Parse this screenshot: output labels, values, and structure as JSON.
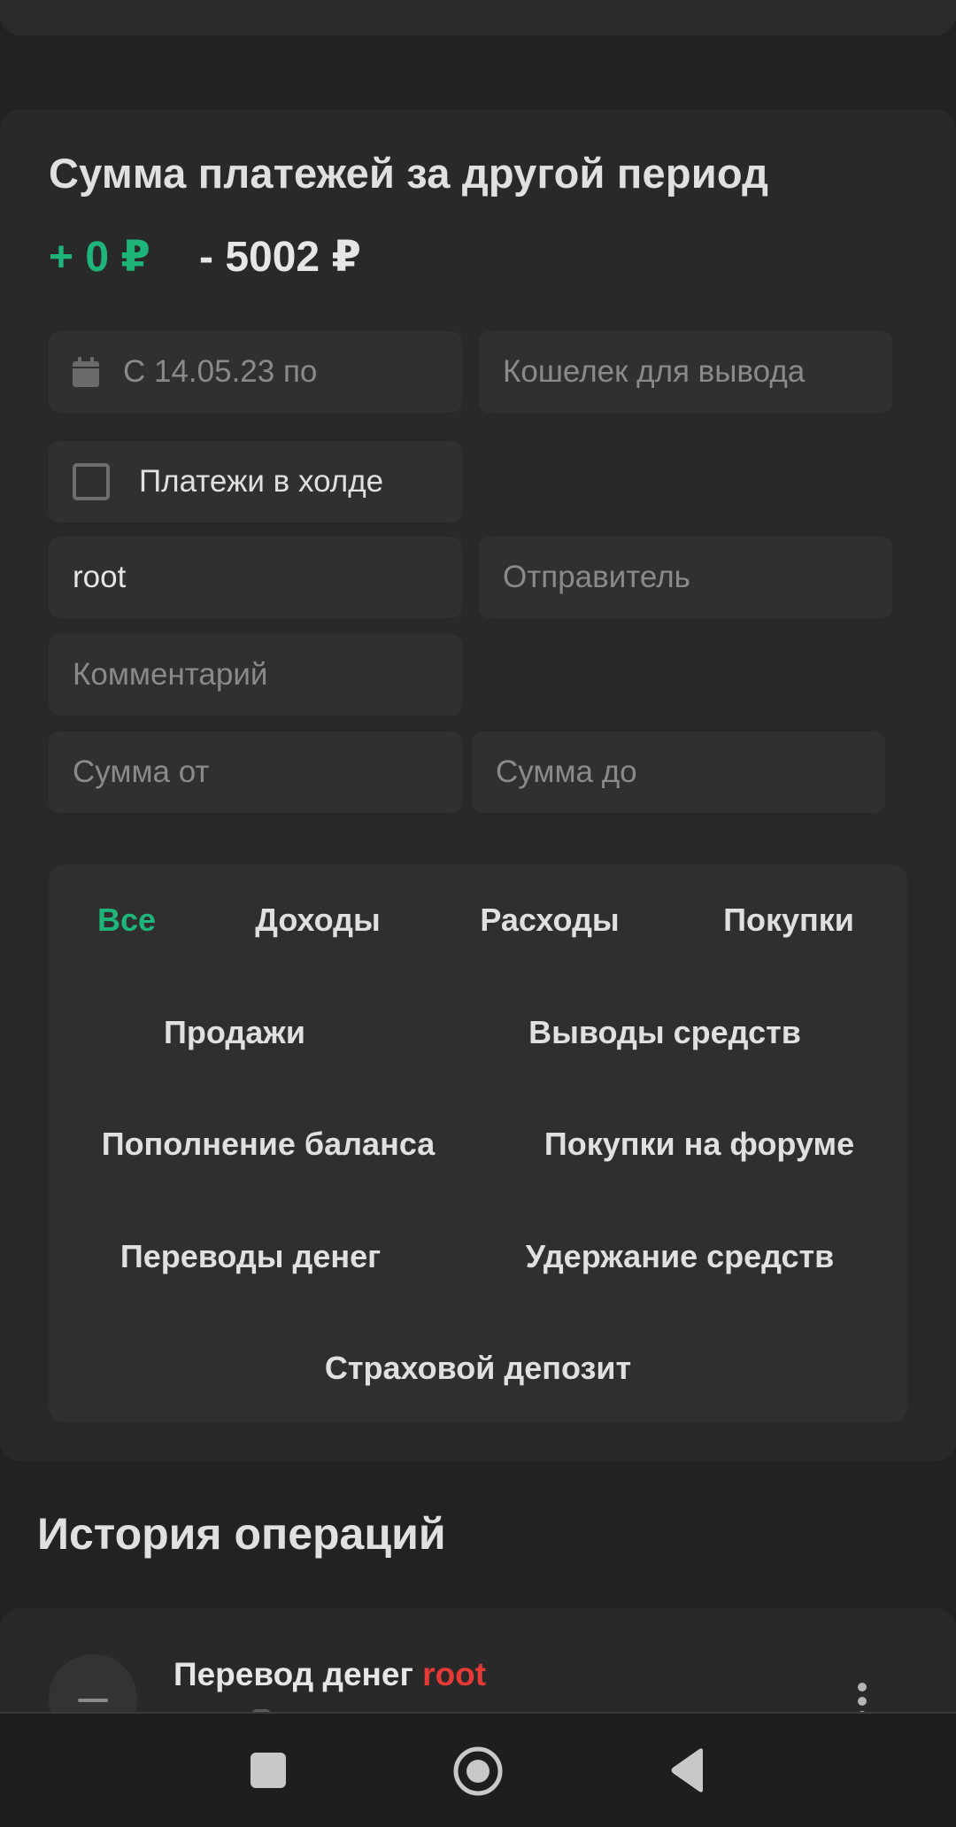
{
  "summary": {
    "title": "Сумма платежей за другой период",
    "income": "+ 0 ₽",
    "expense": "- 5002 ₽"
  },
  "filters": {
    "date_range": "С 14.05.23 по",
    "wallet_placeholder": "Кошелек для вывода",
    "hold_checkbox_label": "Платежи в холде",
    "hold_checked": false,
    "user_value": "root",
    "sender_placeholder": "Отправитель",
    "comment_placeholder": "Комментарий",
    "amount_from_placeholder": "Сумма от",
    "amount_to_placeholder": "Сумма до"
  },
  "tabs": [
    {
      "label": "Все",
      "active": true
    },
    {
      "label": "Доходы",
      "active": false
    },
    {
      "label": "Расходы",
      "active": false
    },
    {
      "label": "Покупки",
      "active": false
    },
    {
      "label": "Продажи",
      "active": false
    },
    {
      "label": "Выводы средств",
      "active": false
    },
    {
      "label": "Пополнение баланса",
      "active": false
    },
    {
      "label": "Покупки на форуме",
      "active": false
    },
    {
      "label": "Переводы денег",
      "active": false
    },
    {
      "label": "Удержание средств",
      "active": false
    },
    {
      "label": "Страховой депозит",
      "active": false
    }
  ],
  "history": {
    "title": "История операций",
    "operations": [
      {
        "type_label": "Перевод денег",
        "user": "root",
        "icon": "minus-icon"
      }
    ]
  },
  "navbar": {
    "icons": [
      "recents-square-icon",
      "home-circle-icon",
      "back-triangle-icon"
    ]
  },
  "colors": {
    "accent_green": "#1fb57a",
    "user_red": "#e53935",
    "background": "#222222",
    "card": "#292929",
    "field": "#303030"
  }
}
